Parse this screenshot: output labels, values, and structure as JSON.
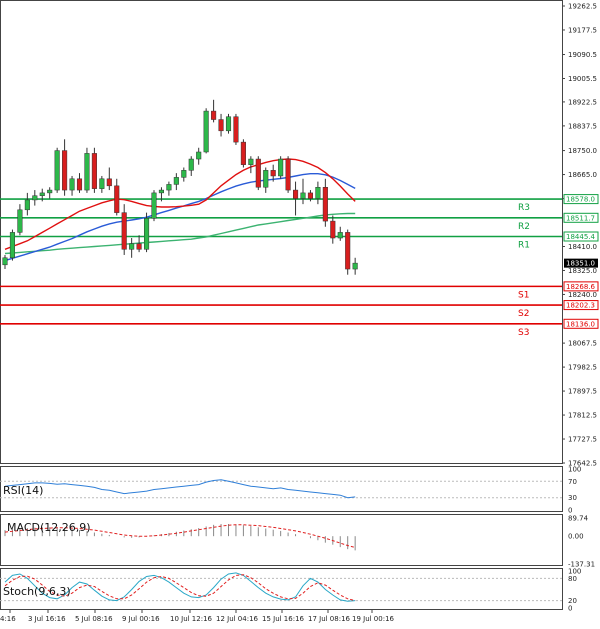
{
  "chart_data": {
    "type": "candlestick",
    "main": {
      "price_axis_ticks": [
        19262.5,
        19177.5,
        19090.5,
        19005.5,
        18922.5,
        18837.5,
        18750.0,
        18665.0,
        18580.0,
        18410.0,
        18325.0,
        18240.0,
        18067.5,
        17982.5,
        17897.5,
        17812.5,
        17727.5,
        17642.5
      ],
      "ylim": [
        17642.5,
        19262.5
      ],
      "current_price": "18351.0",
      "levels": [
        {
          "name": "R3",
          "value": 18578.0,
          "label": "18578.0",
          "color": "#11a043"
        },
        {
          "name": "R2",
          "value": 18511.7,
          "label": "18511.7",
          "color": "#11a043"
        },
        {
          "name": "R1",
          "value": 18445.4,
          "label": "18445.4",
          "color": "#11a043"
        },
        {
          "name": "S1",
          "value": 18268.6,
          "label": "18268.6",
          "color": "#e00000"
        },
        {
          "name": "S2",
          "value": 18202.3,
          "label": "18202.3",
          "color": "#e00000"
        },
        {
          "name": "S3",
          "value": 18136.0,
          "label": "18136.0",
          "color": "#e00000"
        }
      ],
      "candles": [
        {
          "o": 18345,
          "h": 18380,
          "l": 18330,
          "c": 18370
        },
        {
          "o": 18370,
          "h": 18470,
          "l": 18360,
          "c": 18460
        },
        {
          "o": 18460,
          "h": 18560,
          "l": 18450,
          "c": 18540
        },
        {
          "o": 18540,
          "h": 18600,
          "l": 18520,
          "c": 18575
        },
        {
          "o": 18575,
          "h": 18610,
          "l": 18555,
          "c": 18590
        },
        {
          "o": 18590,
          "h": 18615,
          "l": 18570,
          "c": 18600
        },
        {
          "o": 18600,
          "h": 18620,
          "l": 18580,
          "c": 18610
        },
        {
          "o": 18610,
          "h": 18760,
          "l": 18600,
          "c": 18750
        },
        {
          "o": 18750,
          "h": 18790,
          "l": 18590,
          "c": 18610
        },
        {
          "o": 18610,
          "h": 18660,
          "l": 18590,
          "c": 18650
        },
        {
          "o": 18650,
          "h": 18670,
          "l": 18600,
          "c": 18610
        },
        {
          "o": 18610,
          "h": 18760,
          "l": 18600,
          "c": 18740
        },
        {
          "o": 18740,
          "h": 18760,
          "l": 18600,
          "c": 18615
        },
        {
          "o": 18615,
          "h": 18660,
          "l": 18600,
          "c": 18650
        },
        {
          "o": 18650,
          "h": 18690,
          "l": 18610,
          "c": 18625
        },
        {
          "o": 18625,
          "h": 18650,
          "l": 18520,
          "c": 18530
        },
        {
          "o": 18530,
          "h": 18560,
          "l": 18380,
          "c": 18400
        },
        {
          "o": 18400,
          "h": 18440,
          "l": 18370,
          "c": 18420
        },
        {
          "o": 18420,
          "h": 18450,
          "l": 18390,
          "c": 18400
        },
        {
          "o": 18400,
          "h": 18530,
          "l": 18390,
          "c": 18510
        },
        {
          "o": 18510,
          "h": 18610,
          "l": 18500,
          "c": 18600
        },
        {
          "o": 18600,
          "h": 18620,
          "l": 18570,
          "c": 18610
        },
        {
          "o": 18610,
          "h": 18640,
          "l": 18590,
          "c": 18630
        },
        {
          "o": 18630,
          "h": 18670,
          "l": 18610,
          "c": 18655
        },
        {
          "o": 18655,
          "h": 18690,
          "l": 18640,
          "c": 18680
        },
        {
          "o": 18680,
          "h": 18730,
          "l": 18660,
          "c": 18720
        },
        {
          "o": 18720,
          "h": 18760,
          "l": 18700,
          "c": 18745
        },
        {
          "o": 18745,
          "h": 18900,
          "l": 18740,
          "c": 18890
        },
        {
          "o": 18890,
          "h": 18930,
          "l": 18850,
          "c": 18860
        },
        {
          "o": 18860,
          "h": 18880,
          "l": 18800,
          "c": 18820
        },
        {
          "o": 18820,
          "h": 18880,
          "l": 18810,
          "c": 18870
        },
        {
          "o": 18870,
          "h": 18880,
          "l": 18770,
          "c": 18780
        },
        {
          "o": 18780,
          "h": 18790,
          "l": 18690,
          "c": 18700
        },
        {
          "o": 18700,
          "h": 18730,
          "l": 18670,
          "c": 18720
        },
        {
          "o": 18720,
          "h": 18730,
          "l": 18610,
          "c": 18620
        },
        {
          "o": 18620,
          "h": 18690,
          "l": 18600,
          "c": 18680
        },
        {
          "o": 18680,
          "h": 18700,
          "l": 18640,
          "c": 18660
        },
        {
          "o": 18660,
          "h": 18730,
          "l": 18650,
          "c": 18720
        },
        {
          "o": 18720,
          "h": 18730,
          "l": 18600,
          "c": 18610
        },
        {
          "o": 18610,
          "h": 18640,
          "l": 18520,
          "c": 18580
        },
        {
          "o": 18580,
          "h": 18650,
          "l": 18560,
          "c": 18600
        },
        {
          "o": 18600,
          "h": 18610,
          "l": 18570,
          "c": 18580
        },
        {
          "o": 18580,
          "h": 18640,
          "l": 18560,
          "c": 18620
        },
        {
          "o": 18620,
          "h": 18650,
          "l": 18480,
          "c": 18500
        },
        {
          "o": 18500,
          "h": 18520,
          "l": 18420,
          "c": 18440
        },
        {
          "o": 18440,
          "h": 18480,
          "l": 18430,
          "c": 18460
        },
        {
          "o": 18460,
          "h": 18470,
          "l": 18310,
          "c": 18330
        },
        {
          "o": 18330,
          "h": 18370,
          "l": 18310,
          "c": 18351
        }
      ],
      "ma_red": [
        18400,
        18410,
        18420,
        18430,
        18445,
        18460,
        18475,
        18490,
        18505,
        18520,
        18535,
        18545,
        18555,
        18565,
        18572,
        18578,
        18576,
        18570,
        18562,
        18555,
        18552,
        18550,
        18550,
        18551,
        18553,
        18556,
        18560,
        18575,
        18600,
        18625,
        18645,
        18665,
        18680,
        18692,
        18700,
        18708,
        18714,
        18718,
        18720,
        18718,
        18712,
        18702,
        18690,
        18672,
        18650,
        18624,
        18596,
        18570
      ],
      "ma_blue": [
        18360,
        18368,
        18376,
        18384,
        18392,
        18400,
        18408,
        18418,
        18428,
        18438,
        18450,
        18462,
        18472,
        18482,
        18490,
        18496,
        18500,
        18504,
        18508,
        18514,
        18522,
        18530,
        18538,
        18546,
        18554,
        18562,
        18570,
        18580,
        18592,
        18604,
        18614,
        18624,
        18632,
        18638,
        18642,
        18645,
        18648,
        18651,
        18655,
        18660,
        18665,
        18668,
        18668,
        18664,
        18656,
        18644,
        18630,
        18616
      ],
      "ma_green": [
        18385,
        18387,
        18389,
        18391,
        18393,
        18395,
        18397,
        18400,
        18402,
        18404,
        18406,
        18408,
        18410,
        18412,
        18414,
        18416,
        18418,
        18420,
        18422,
        18424,
        18426,
        18428,
        18430,
        18432,
        18434,
        18436,
        18440,
        18444,
        18450,
        18456,
        18462,
        18468,
        18474,
        18480,
        18486,
        18490,
        18494,
        18498,
        18502,
        18506,
        18510,
        18514,
        18518,
        18522,
        18524,
        18526,
        18527,
        18527
      ]
    },
    "rsi": {
      "label": "RSI(14)",
      "ticks": [
        100,
        70,
        30,
        0
      ],
      "values": [
        58,
        60,
        62,
        64,
        66,
        66,
        65,
        63,
        64,
        62,
        60,
        58,
        55,
        50,
        48,
        44,
        40,
        42,
        44,
        46,
        50,
        52,
        54,
        56,
        58,
        60,
        62,
        68,
        72,
        74,
        70,
        66,
        62,
        58,
        56,
        54,
        52,
        54,
        50,
        48,
        46,
        44,
        42,
        40,
        38,
        36,
        30,
        32
      ]
    },
    "macd": {
      "label": "MACD(12,26,9)",
      "ticks": [
        "89.74",
        "0.00",
        "-137.31"
      ],
      "ylim": [
        -137.31,
        89.74
      ],
      "hist": [
        30,
        34,
        38,
        40,
        42,
        44,
        44,
        44,
        40,
        36,
        30,
        24,
        18,
        12,
        6,
        0,
        -6,
        -8,
        -6,
        -2,
        4,
        10,
        16,
        22,
        28,
        34,
        40,
        48,
        56,
        60,
        60,
        58,
        54,
        50,
        44,
        38,
        32,
        26,
        18,
        10,
        0,
        -10,
        -20,
        -32,
        -42,
        -54,
        -64,
        -70
      ],
      "signal": [
        20,
        24,
        28,
        32,
        36,
        38,
        40,
        42,
        42,
        40,
        38,
        34,
        30,
        24,
        18,
        12,
        6,
        2,
        0,
        0,
        2,
        6,
        10,
        14,
        20,
        26,
        32,
        38,
        44,
        50,
        54,
        56,
        56,
        54,
        52,
        48,
        44,
        38,
        32,
        26,
        18,
        10,
        0,
        -10,
        -22,
        -34,
        -46,
        -56
      ]
    },
    "stoch": {
      "label": "Stoch(9,6,3)",
      "ticks": [
        100,
        80,
        20,
        0
      ],
      "k": [
        70,
        88,
        92,
        80,
        60,
        40,
        28,
        25,
        35,
        55,
        70,
        65,
        48,
        32,
        22,
        20,
        30,
        50,
        72,
        85,
        88,
        82,
        70,
        55,
        40,
        30,
        28,
        35,
        55,
        78,
        92,
        95,
        88,
        72,
        55,
        40,
        30,
        24,
        22,
        30,
        60,
        80,
        70,
        50,
        35,
        22,
        18,
        20
      ],
      "d": [
        60,
        75,
        85,
        86,
        78,
        62,
        45,
        35,
        32,
        40,
        55,
        62,
        58,
        45,
        33,
        25,
        25,
        35,
        52,
        70,
        82,
        85,
        80,
        68,
        55,
        42,
        33,
        32,
        40,
        58,
        76,
        88,
        90,
        82,
        68,
        52,
        40,
        30,
        25,
        26,
        40,
        58,
        68,
        62,
        48,
        35,
        25,
        20
      ]
    },
    "x_ticks": [
      "4:16",
      "3 Jul 16:16",
      "5 Jul 08:16",
      "9 Jul 00:16",
      "10 Jul 12:16",
      "12 Jul 04:16",
      "15 Jul 16:16",
      "17 Jul 08:16",
      "19 Jul 00:16"
    ]
  }
}
